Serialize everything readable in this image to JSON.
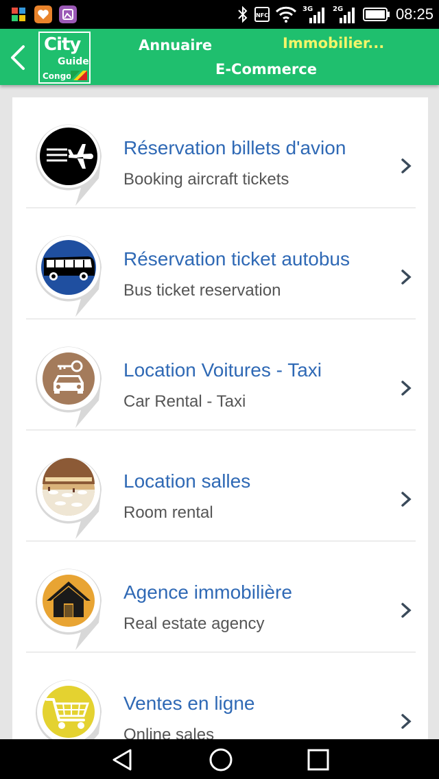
{
  "status_bar": {
    "time": "08:25",
    "network_1": "3G",
    "network_2": "2G",
    "nfc": "NFC",
    "app_icons": [
      "puzzle-app-icon",
      "heart-app-icon",
      "gallery-app-icon"
    ]
  },
  "header": {
    "logo": {
      "line1": "City",
      "line2": "Guide",
      "line3": "Congo"
    },
    "tabs": [
      {
        "label": "Annuaire"
      },
      {
        "label": "Immobilier..."
      },
      {
        "label": "E-Commerce"
      }
    ],
    "colors": {
      "bar": "#1fbf6e",
      "active_tab": "#f2f56a"
    }
  },
  "items": [
    {
      "title": "Réservation billets d'avion",
      "subtitle": "Booking aircraft tickets",
      "icon": "airplane-icon",
      "color": "#000000"
    },
    {
      "title": "Réservation ticket autobus",
      "subtitle": "Bus ticket reservation",
      "icon": "bus-icon",
      "color": "#1f4fa0"
    },
    {
      "title": "Location Voitures - Taxi",
      "subtitle": "Car Rental - Taxi",
      "icon": "car-key-icon",
      "color": "#a47b5b"
    },
    {
      "title": "Location salles",
      "subtitle": "Room rental",
      "icon": "banquet-room-photo",
      "color": "#b9875a"
    },
    {
      "title": "Agence immobilière",
      "subtitle": "Real estate agency",
      "icon": "house-icon",
      "color": "#e8a433"
    },
    {
      "title": "Ventes en ligne",
      "subtitle": "Online sales",
      "icon": "shopping-cart-icon",
      "color": "#e4d230"
    }
  ],
  "theme": {
    "title_color": "#2f69b5",
    "subtitle_color": "#555555"
  }
}
